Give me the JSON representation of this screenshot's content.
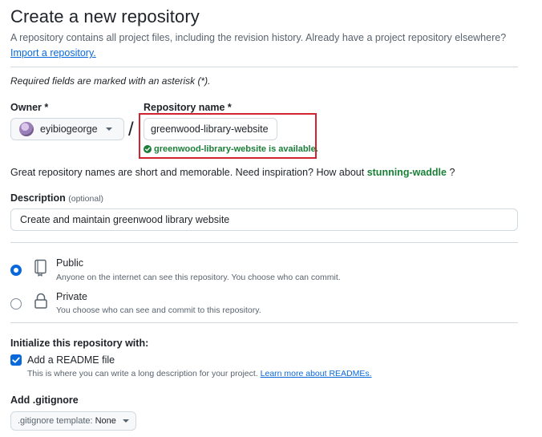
{
  "header": {
    "title": "Create a new repository",
    "subtitle": "A repository contains all project files, including the revision history. Already have a project repository elsewhere?",
    "import_link": "Import a repository."
  },
  "required_note": "Required fields are marked with an asterisk (*).",
  "owner": {
    "label": "Owner *",
    "value": "eyibiogeorge"
  },
  "separator": "/",
  "repository_name": {
    "label": "Repository name *",
    "value": "greenwood-library-website",
    "availability": "greenwood-library-website is available."
  },
  "inspiration": {
    "text": "Great repository names are short and memorable. Need inspiration? How about",
    "suggestion": "stunning-waddle",
    "suffix": "?"
  },
  "description": {
    "label": "Description",
    "optional": "(optional)",
    "value": "Create and maintain greenwood library website"
  },
  "visibility": {
    "public": {
      "title": "Public",
      "description": "Anyone on the internet can see this repository. You choose who can commit.",
      "selected": true
    },
    "private": {
      "title": "Private",
      "description": "You choose who can see and commit to this repository.",
      "selected": false
    }
  },
  "initialize": {
    "heading": "Initialize this repository with:",
    "readme": {
      "label": "Add a README file",
      "checked": true,
      "description": "This is where you can write a long description for your project.",
      "learn_more": "Learn more about READMEs."
    }
  },
  "gitignore": {
    "heading": "Add .gitignore",
    "prefix": ".gitignore template:",
    "value": "None"
  },
  "colors": {
    "accent": "#0969da",
    "success": "#1a7f37",
    "highlight": "#d1242f"
  }
}
